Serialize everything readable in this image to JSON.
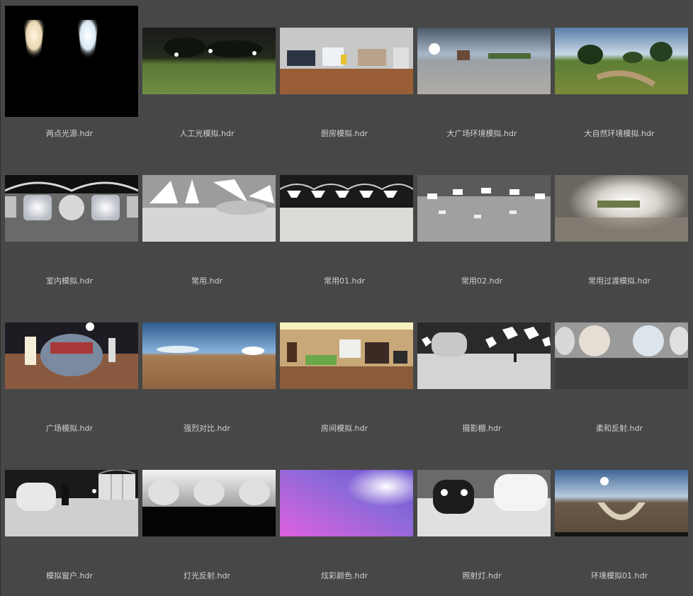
{
  "files": [
    {
      "name": "两点光源.hdr"
    },
    {
      "name": "人工光模拟.hdr"
    },
    {
      "name": "厨房模拟.hdr"
    },
    {
      "name": "大广场环境模拟.hdr"
    },
    {
      "name": "大自然环境模拟.hdr"
    },
    {
      "name": "室内模拟.hdr"
    },
    {
      "name": "常用.hdr"
    },
    {
      "name": "常用01.hdr"
    },
    {
      "name": "常用02.hdr"
    },
    {
      "name": "常用过渡模拟.hdr"
    },
    {
      "name": "广场模拟.hdr"
    },
    {
      "name": "强烈对比.hdr"
    },
    {
      "name": "房间模拟.hdr"
    },
    {
      "name": "摄影棚.hdr"
    },
    {
      "name": "柔和反射.hdr"
    },
    {
      "name": "模拟窗户.hdr"
    },
    {
      "name": "灯光反射.hdr"
    },
    {
      "name": "炫彩颜色.hdr"
    },
    {
      "name": "照射灯.hdr"
    },
    {
      "name": "环境模拟01.hdr"
    }
  ],
  "colors": {
    "background": "#474747",
    "label": "#d2d2d2"
  }
}
